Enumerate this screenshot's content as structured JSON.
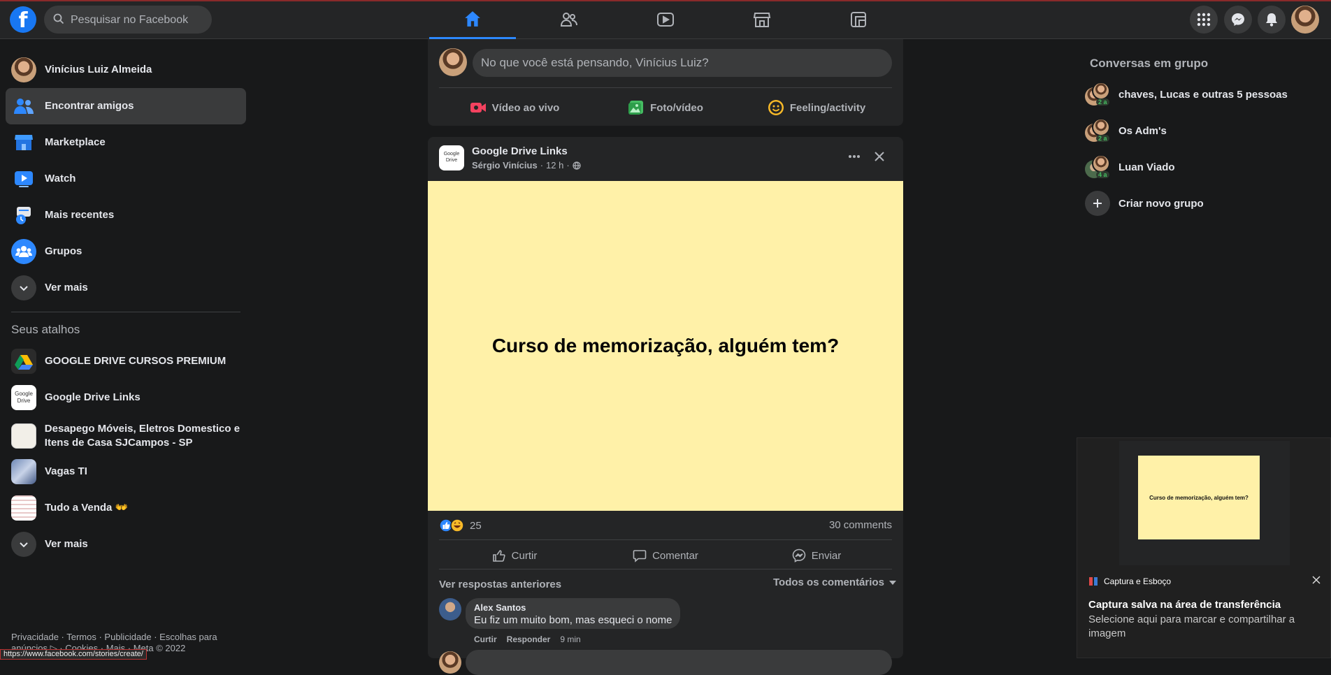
{
  "header": {
    "search_placeholder": "Pesquisar no Facebook",
    "logo_letter": "f"
  },
  "sidebar": {
    "profile_name": "Vinícius Luiz Almeida",
    "items": [
      {
        "label": "Encontrar amigos",
        "icon": "friends-icon"
      },
      {
        "label": "Marketplace",
        "icon": "marketplace-icon"
      },
      {
        "label": "Watch",
        "icon": "watch-icon"
      },
      {
        "label": "Mais recentes",
        "icon": "recent-icon"
      },
      {
        "label": "Grupos",
        "icon": "groups-icon"
      },
      {
        "label": "Ver mais",
        "icon": "chevron-down-icon"
      }
    ],
    "shortcuts_title": "Seus atalhos",
    "shortcuts": [
      {
        "label": "GOOGLE DRIVE CURSOS PREMIUM"
      },
      {
        "label": "Google Drive Links"
      },
      {
        "label": "Desapego Móveis, Eletros Domestico e Itens de Casa SJCampos - SP"
      },
      {
        "label": "Vagas TI"
      },
      {
        "label": "Tudo a Venda 👐"
      },
      {
        "label": "Ver mais"
      }
    ],
    "footer": "Privacidade · Termos · Publicidade · Escolhas para anúncios ▷ · Cookies · Mais · Meta © 2022",
    "status_url": "https://www.facebook.com/stories/create/"
  },
  "composer": {
    "placeholder": "No que você está pensando, Vinícius Luiz?",
    "actions": [
      {
        "label": "Vídeo ao vivo",
        "color": "#f3425f"
      },
      {
        "label": "Foto/vídeo",
        "color": "#45bd62"
      },
      {
        "label": "Feeling/activity",
        "color": "#f7b928"
      }
    ]
  },
  "post": {
    "group_name": "Google Drive Links",
    "author": "Sérgio Vinícius",
    "time": "12 h",
    "text": "Curso de memorização, alguém tem?",
    "background_color": "#fff1a8",
    "reaction_count": "25",
    "comments_count": "30 comments",
    "buttons": [
      "Curtir",
      "Comentar",
      "Enviar"
    ],
    "view_previous": "Ver respostas anteriores",
    "filter": "Todos os comentários",
    "comment": {
      "author": "Alex Santos",
      "text": "Eu fiz um muito bom, mas esqueci o nome",
      "like": "Curtir",
      "reply": "Responder",
      "time": "9 min"
    }
  },
  "right": {
    "title": "Conversas em grupo",
    "groups": [
      {
        "label": "chaves, Lucas e outras 5 pessoas",
        "badge": "2 a"
      },
      {
        "label": "Os Adm's",
        "badge": "2 a"
      },
      {
        "label": "Luan Viado",
        "badge": "4 a"
      }
    ],
    "create": "Criar novo grupo"
  },
  "toast": {
    "app": "Captura e Esboço",
    "title": "Captura salva na área de transferência",
    "body": "Selecione aqui para marcar e compartilhar a imagem",
    "thumb_text": "Curso de memorização, alguém tem?"
  }
}
